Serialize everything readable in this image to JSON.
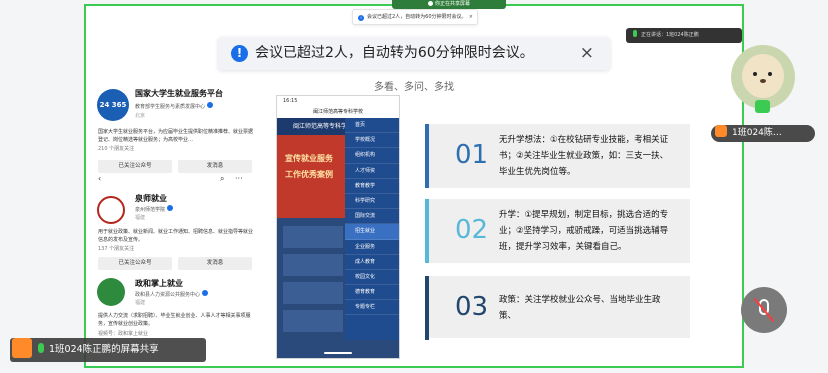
{
  "meeting": {
    "top_sharing_note": "你正在共享屏幕",
    "small_notice": "会议已超过2人，自动转为60分钟限时会议。",
    "small_notice_close": "×",
    "speaking_label": "正在讲话：1班024陈正鹏",
    "big_notice": "会议已超过2人，自动转为60分钟限时会议。",
    "big_notice_icon": "!",
    "big_notice_close": "×",
    "participant_tag": "1班024陈…",
    "share_label": "1班024陈正鹏的屏幕共享",
    "colors": {
      "frame_border": "#3ccb52",
      "info_blue": "#1a6fe8",
      "mic_green": "#3ccb52"
    }
  },
  "wechat": {
    "orgs": [
      {
        "name": "国家大学生就业服务平台",
        "subtitle": "教育部学生服务与素质发展中心",
        "location": "北京",
        "logo_text": "24 365",
        "desc": "国家大学生就业服务平台，为应届毕业生提供职位精准推荐、就业票据登记、岗位精选等就业服务；为高校毕业…",
        "friends": "210 个朋友关注",
        "btn_following": "已关注公众号",
        "btn_message": "发消息"
      },
      {
        "name": "泉师就业",
        "subtitle": "泉州师范学院",
        "location": "福建",
        "logo_text": "",
        "desc": "用于就业政策、就业新闻、就业工作通知、招聘信息、就业指导等就业信息的发布及宣传。",
        "friends": "137 个朋友关注",
        "btn_following": "已关注公众号",
        "btn_message": "发消息"
      },
      {
        "name": "政和掌上就业",
        "subtitle": "政和县人力资源公共服务中心",
        "location": "福建",
        "logo_text": "",
        "desc": "提供人力交流（求职招聘）、毕业生就业创业、人事人才等相关事项服务，宣传就业创业政策。",
        "friends": "视频号：政和掌上就业",
        "btn_following": "",
        "btn_message": ""
      }
    ],
    "nav_back": "‹",
    "nav_icons": [
      "⌕",
      "···"
    ]
  },
  "phone": {
    "time": "16:15",
    "site_title": "闽江师范高等专科学校",
    "banner_title": "闽江师范高等专科学校",
    "hero_line1": "宣传就业服务",
    "hero_line2": "工作优秀案例",
    "menu": [
      "首页",
      "学校概况",
      "组织机构",
      "人才师资",
      "教育教学",
      "科学研究",
      "国际交流",
      "招生就业",
      "企业服务",
      "成人教育",
      "校园文化",
      "德育教育",
      "专题专栏"
    ],
    "menu_active_index": 7
  },
  "slide": {
    "slogan": "多看、多问、多找",
    "items": [
      {
        "num": "01",
        "text": "无升学想法：①在校钻研专业技能，考相关证书；②关注毕业生就业政策，如：三支一扶、毕业生优先岗位等。",
        "color": "#2f6eb1"
      },
      {
        "num": "02",
        "text": "升学：①提早规划，制定目标，挑选合适的专业；②坚持学习，戒骄戒躁，可适当挑选辅导班，提升学习效率，关键看自己。",
        "color": "#58b8d8"
      },
      {
        "num": "03",
        "text": "政策：关注学校就业公众号、当地毕业生政策、",
        "color": "#22466c"
      }
    ]
  }
}
